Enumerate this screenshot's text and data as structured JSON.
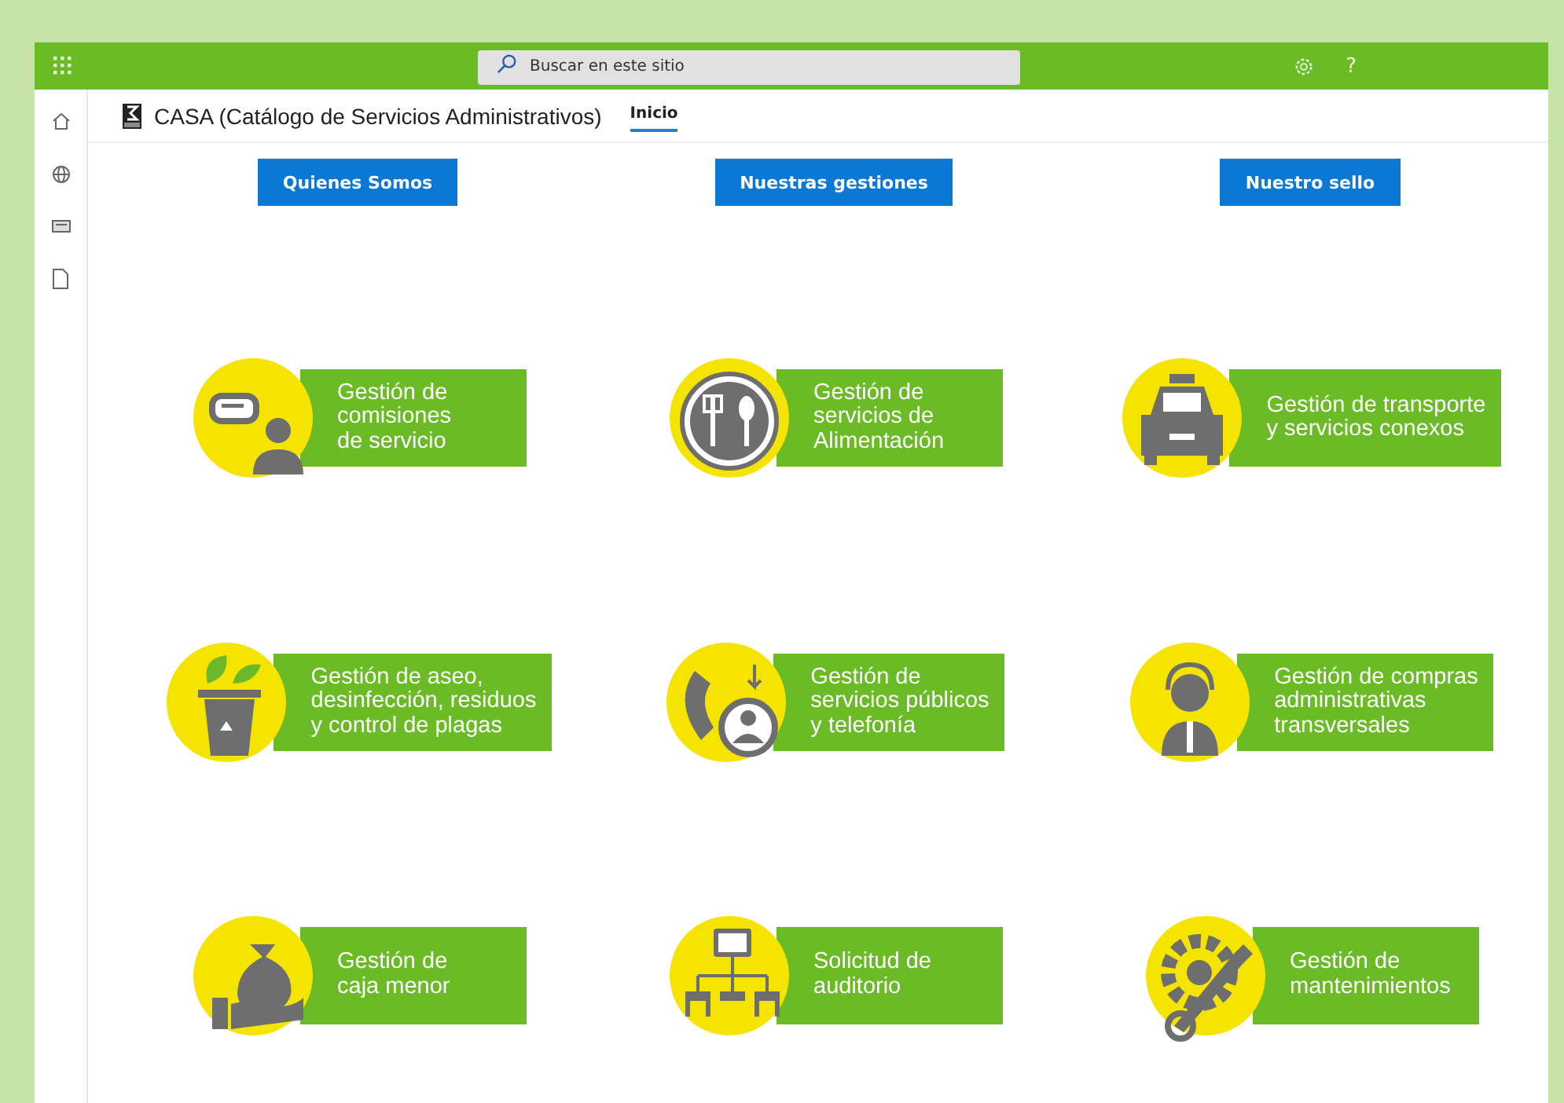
{
  "top_bar": {
    "search": {
      "placeholder": "Buscar en este sitio"
    },
    "help": "?"
  },
  "site": {
    "title": "CASA (Catálogo de Servicios Administrativos)",
    "nav": [
      {
        "label": "Inicio",
        "selected": true
      }
    ]
  },
  "buttons": [
    "Quienes Somos",
    "Nuestras gestiones",
    "Nuestro sello"
  ],
  "tiles": [
    {
      "label": "Gestión de\ncomisiones\nde servicio"
    },
    {
      "label": "Gestión de\nservicios de\nAlimentación"
    },
    {
      "label": "Gestión de transporte\ny servicios conexos"
    },
    {
      "label": "Gestión de aseo,\ndesinfección, residuos\ny control de plagas"
    },
    {
      "label": "Gestión de\nservicios públicos\ny telefonía"
    },
    {
      "label": "Gestión de compras\nadministrativas\ntransversales"
    },
    {
      "label": "Gestión de\ncaja menor"
    },
    {
      "label": "Solicitud de\nauditorio"
    },
    {
      "label": "Gestión de\nmantenimientos"
    }
  ]
}
